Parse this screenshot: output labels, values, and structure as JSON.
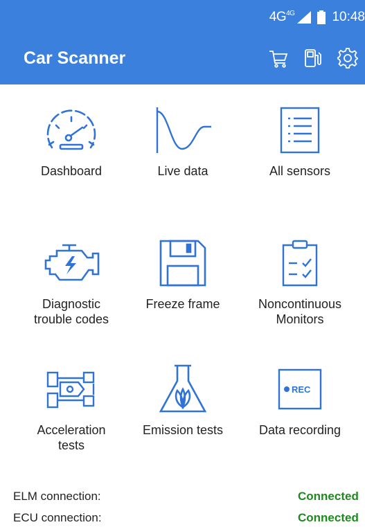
{
  "status_bar": {
    "network": "4G",
    "network_badge": "4G",
    "time": "10:48"
  },
  "app_bar": {
    "title": "Car Scanner",
    "actions": [
      {
        "icon": "cart-icon"
      },
      {
        "icon": "fuel-pump-icon"
      },
      {
        "icon": "gear-icon"
      }
    ]
  },
  "menu": [
    {
      "label": "Dashboard",
      "icon": "speedometer-icon"
    },
    {
      "label": "Live data",
      "icon": "wave-graph-icon"
    },
    {
      "label": "All sensors",
      "icon": "list-document-icon"
    },
    {
      "label": "Diagnostic\ntrouble codes",
      "icon": "engine-icon"
    },
    {
      "label": "Freeze frame",
      "icon": "floppy-disk-icon"
    },
    {
      "label": "Noncontinuous\nMonitors",
      "icon": "clipboard-check-icon"
    },
    {
      "label": "Acceleration\ntests",
      "icon": "race-car-icon"
    },
    {
      "label": "Emission tests",
      "icon": "flask-leaf-icon"
    },
    {
      "label": "Data recording",
      "icon": "rec-icon",
      "rec_text": "REC"
    }
  ],
  "connections": {
    "elm_label": "ELM connection:",
    "elm_value": "Connected",
    "ecu_label": "ECU connection:",
    "ecu_value": "Connected"
  },
  "colors": {
    "app_bar": "#3a80dc",
    "icon_blue": "#2f73d6",
    "connected_green": "#1e8a1e"
  }
}
